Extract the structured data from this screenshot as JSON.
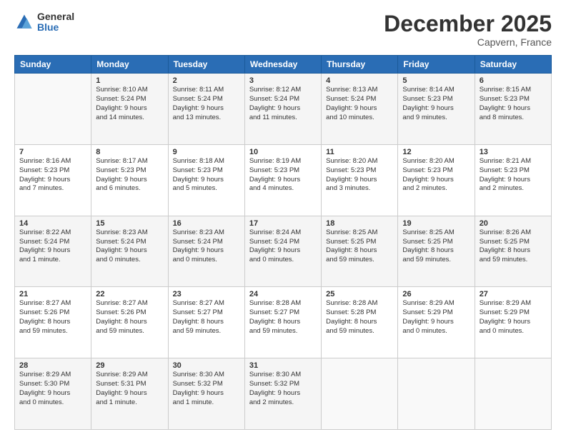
{
  "logo": {
    "general": "General",
    "blue": "Blue"
  },
  "header": {
    "title": "December 2025",
    "location": "Capvern, France"
  },
  "weekdays": [
    "Sunday",
    "Monday",
    "Tuesday",
    "Wednesday",
    "Thursday",
    "Friday",
    "Saturday"
  ],
  "weeks": [
    [
      {
        "day": "",
        "info": ""
      },
      {
        "day": "1",
        "info": "Sunrise: 8:10 AM\nSunset: 5:24 PM\nDaylight: 9 hours\nand 14 minutes."
      },
      {
        "day": "2",
        "info": "Sunrise: 8:11 AM\nSunset: 5:24 PM\nDaylight: 9 hours\nand 13 minutes."
      },
      {
        "day": "3",
        "info": "Sunrise: 8:12 AM\nSunset: 5:24 PM\nDaylight: 9 hours\nand 11 minutes."
      },
      {
        "day": "4",
        "info": "Sunrise: 8:13 AM\nSunset: 5:24 PM\nDaylight: 9 hours\nand 10 minutes."
      },
      {
        "day": "5",
        "info": "Sunrise: 8:14 AM\nSunset: 5:23 PM\nDaylight: 9 hours\nand 9 minutes."
      },
      {
        "day": "6",
        "info": "Sunrise: 8:15 AM\nSunset: 5:23 PM\nDaylight: 9 hours\nand 8 minutes."
      }
    ],
    [
      {
        "day": "7",
        "info": "Sunrise: 8:16 AM\nSunset: 5:23 PM\nDaylight: 9 hours\nand 7 minutes."
      },
      {
        "day": "8",
        "info": "Sunrise: 8:17 AM\nSunset: 5:23 PM\nDaylight: 9 hours\nand 6 minutes."
      },
      {
        "day": "9",
        "info": "Sunrise: 8:18 AM\nSunset: 5:23 PM\nDaylight: 9 hours\nand 5 minutes."
      },
      {
        "day": "10",
        "info": "Sunrise: 8:19 AM\nSunset: 5:23 PM\nDaylight: 9 hours\nand 4 minutes."
      },
      {
        "day": "11",
        "info": "Sunrise: 8:20 AM\nSunset: 5:23 PM\nDaylight: 9 hours\nand 3 minutes."
      },
      {
        "day": "12",
        "info": "Sunrise: 8:20 AM\nSunset: 5:23 PM\nDaylight: 9 hours\nand 2 minutes."
      },
      {
        "day": "13",
        "info": "Sunrise: 8:21 AM\nSunset: 5:23 PM\nDaylight: 9 hours\nand 2 minutes."
      }
    ],
    [
      {
        "day": "14",
        "info": "Sunrise: 8:22 AM\nSunset: 5:24 PM\nDaylight: 9 hours\nand 1 minute."
      },
      {
        "day": "15",
        "info": "Sunrise: 8:23 AM\nSunset: 5:24 PM\nDaylight: 9 hours\nand 0 minutes."
      },
      {
        "day": "16",
        "info": "Sunrise: 8:23 AM\nSunset: 5:24 PM\nDaylight: 9 hours\nand 0 minutes."
      },
      {
        "day": "17",
        "info": "Sunrise: 8:24 AM\nSunset: 5:24 PM\nDaylight: 9 hours\nand 0 minutes."
      },
      {
        "day": "18",
        "info": "Sunrise: 8:25 AM\nSunset: 5:25 PM\nDaylight: 8 hours\nand 59 minutes."
      },
      {
        "day": "19",
        "info": "Sunrise: 8:25 AM\nSunset: 5:25 PM\nDaylight: 8 hours\nand 59 minutes."
      },
      {
        "day": "20",
        "info": "Sunrise: 8:26 AM\nSunset: 5:25 PM\nDaylight: 8 hours\nand 59 minutes."
      }
    ],
    [
      {
        "day": "21",
        "info": "Sunrise: 8:27 AM\nSunset: 5:26 PM\nDaylight: 8 hours\nand 59 minutes."
      },
      {
        "day": "22",
        "info": "Sunrise: 8:27 AM\nSunset: 5:26 PM\nDaylight: 8 hours\nand 59 minutes."
      },
      {
        "day": "23",
        "info": "Sunrise: 8:27 AM\nSunset: 5:27 PM\nDaylight: 8 hours\nand 59 minutes."
      },
      {
        "day": "24",
        "info": "Sunrise: 8:28 AM\nSunset: 5:27 PM\nDaylight: 8 hours\nand 59 minutes."
      },
      {
        "day": "25",
        "info": "Sunrise: 8:28 AM\nSunset: 5:28 PM\nDaylight: 8 hours\nand 59 minutes."
      },
      {
        "day": "26",
        "info": "Sunrise: 8:29 AM\nSunset: 5:29 PM\nDaylight: 9 hours\nand 0 minutes."
      },
      {
        "day": "27",
        "info": "Sunrise: 8:29 AM\nSunset: 5:29 PM\nDaylight: 9 hours\nand 0 minutes."
      }
    ],
    [
      {
        "day": "28",
        "info": "Sunrise: 8:29 AM\nSunset: 5:30 PM\nDaylight: 9 hours\nand 0 minutes."
      },
      {
        "day": "29",
        "info": "Sunrise: 8:29 AM\nSunset: 5:31 PM\nDaylight: 9 hours\nand 1 minute."
      },
      {
        "day": "30",
        "info": "Sunrise: 8:30 AM\nSunset: 5:32 PM\nDaylight: 9 hours\nand 1 minute."
      },
      {
        "day": "31",
        "info": "Sunrise: 8:30 AM\nSunset: 5:32 PM\nDaylight: 9 hours\nand 2 minutes."
      },
      {
        "day": "",
        "info": ""
      },
      {
        "day": "",
        "info": ""
      },
      {
        "day": "",
        "info": ""
      }
    ]
  ]
}
